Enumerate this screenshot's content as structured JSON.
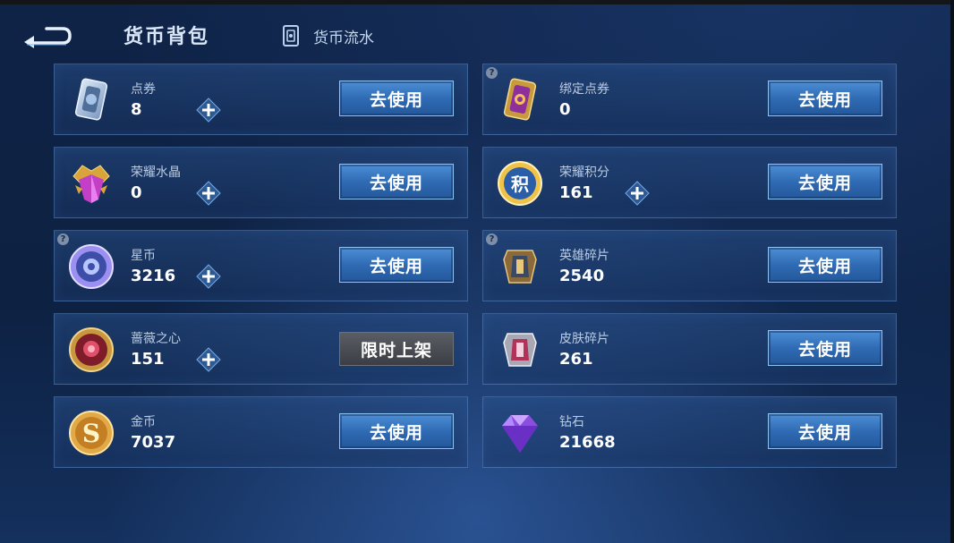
{
  "header": {
    "title": "货币背包",
    "flow_label": "货币流水"
  },
  "colors": {
    "accent": "#3b7cc6",
    "card_border": "#78aae6",
    "background": "#0f2347"
  },
  "items": [
    {
      "name": "点券",
      "amount": "8",
      "icon": "coupon-icon",
      "has_plus": true,
      "has_help": false,
      "action": "去使用"
    },
    {
      "name": "绑定点券",
      "amount": "0",
      "icon": "bound-coupon-icon",
      "has_plus": false,
      "has_help": true,
      "action": "去使用"
    },
    {
      "name": "荣耀水晶",
      "amount": "0",
      "icon": "glory-crystal-icon",
      "has_plus": true,
      "has_help": false,
      "action": "去使用"
    },
    {
      "name": "荣耀积分",
      "amount": "161",
      "icon": "glory-points-icon",
      "has_plus": true,
      "has_help": false,
      "action": "去使用"
    },
    {
      "name": "星币",
      "amount": "3216",
      "icon": "star-coin-icon",
      "has_plus": true,
      "has_help": true,
      "action": "去使用"
    },
    {
      "name": "英雄碎片",
      "amount": "2540",
      "icon": "hero-shard-icon",
      "has_plus": false,
      "has_help": true,
      "action": "去使用"
    },
    {
      "name": "蔷薇之心",
      "amount": "151",
      "icon": "rose-heart-icon",
      "has_plus": true,
      "has_help": false,
      "action": "限时上架"
    },
    {
      "name": "皮肤碎片",
      "amount": "261",
      "icon": "skin-shard-icon",
      "has_plus": false,
      "has_help": false,
      "action": "去使用"
    },
    {
      "name": "金币",
      "amount": "7037",
      "icon": "gold-coin-icon",
      "has_plus": false,
      "has_help": false,
      "action": "去使用"
    },
    {
      "name": "钻石",
      "amount": "21668",
      "icon": "diamond-icon",
      "has_plus": false,
      "has_help": false,
      "action": "去使用"
    }
  ]
}
